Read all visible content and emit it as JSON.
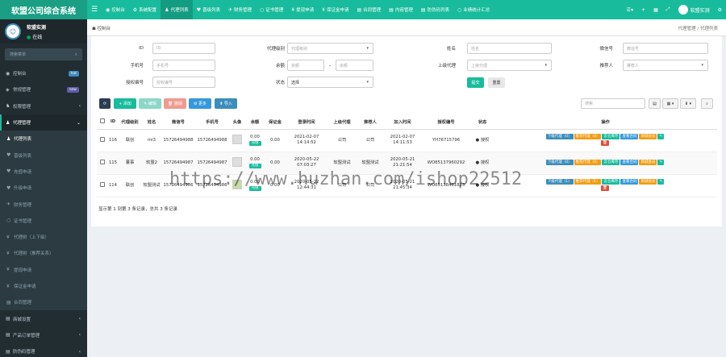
{
  "app": {
    "brand": "软盟公司综合系统"
  },
  "topnav": {
    "toggle": "☰",
    "items": [
      {
        "icon": "◉",
        "label": "控制台"
      },
      {
        "icon": "⚙",
        "label": "系统配置"
      },
      {
        "icon": "♟",
        "label": "代理列表"
      },
      {
        "icon": "♥",
        "label": "晋级列表"
      },
      {
        "icon": "✈",
        "label": "财务管理"
      },
      {
        "icon": "○",
        "label": "证书管理"
      },
      {
        "icon": "¥",
        "label": "提现申请"
      },
      {
        "icon": "¥",
        "label": "保证金申请"
      },
      {
        "icon": "▤",
        "label": "合同管理"
      },
      {
        "icon": "▤",
        "label": "内容管理"
      },
      {
        "icon": "▤",
        "label": "防伪码列表"
      },
      {
        "icon": "○",
        "label": "业绩统计汇总"
      }
    ],
    "right": {
      "menu": "☰",
      "lang": "▾",
      "plus": "+",
      "grid": "▦",
      "fullscreen": "⤢",
      "user": "软盟实测",
      "gear": "⚙"
    }
  },
  "sidebar": {
    "user_name": "软盟实测",
    "user_status": "在线",
    "search_placeholder": "搜索菜单",
    "items": [
      {
        "icon": "◉",
        "label": "控制台",
        "badge": "hot",
        "badge_color": "#3c8dbc"
      },
      {
        "icon": "◈",
        "label": "常规管理",
        "badge": "new",
        "badge_color": "#605ca8"
      },
      {
        "icon": "♞",
        "label": "权限管理",
        "arrow": "‹"
      },
      {
        "icon": "♟",
        "label": "代理管理",
        "arrow": "⌄"
      }
    ],
    "subitems": [
      {
        "icon": "♟",
        "label": "代理列表"
      },
      {
        "icon": "♥",
        "label": "晋级列表"
      },
      {
        "icon": "♥",
        "label": "充值申请"
      },
      {
        "icon": "♥",
        "label": "升级申请"
      },
      {
        "icon": "✈",
        "label": "财务管理"
      },
      {
        "icon": "○",
        "label": "证书管理"
      },
      {
        "icon": "¥",
        "label": "代理树（上下级）"
      },
      {
        "icon": "¥",
        "label": "代理树（推荐关系）"
      },
      {
        "icon": "¥",
        "label": "提现申请"
      },
      {
        "icon": "¥",
        "label": "保证金申请"
      },
      {
        "icon": "▤",
        "label": "合同管理"
      }
    ],
    "bottom_items": [
      {
        "icon": "▤",
        "label": "商城设置"
      },
      {
        "icon": "▤",
        "label": "产品订单管理"
      },
      {
        "icon": "▤",
        "label": "防伪码管理"
      }
    ]
  },
  "breadcrumb": {
    "left": "☗ 控制台",
    "right": "代理管理 / 代理列表"
  },
  "search_form": {
    "id_label": "ID",
    "id_placeholder": "ID",
    "level_label": "代理级别",
    "level_value": "代理级别",
    "name_label": "姓名",
    "name_placeholder": "姓名",
    "wechat_label": "微信号",
    "wechat_placeholder": "微信号",
    "phone_label": "手机号",
    "phone_placeholder": "手机号",
    "balance_label": "余额",
    "balance_min": "余额",
    "balance_sep": "-",
    "balance_max": "余额",
    "parent_label": "上级代理",
    "parent_value": "上级代理",
    "referrer_label": "推荐人",
    "referrer_value": "推荐人",
    "auth_label": "授权编号",
    "auth_placeholder": "授权编号",
    "status_label": "状态",
    "status_value": "选择",
    "submit": "提交",
    "reset": "重置"
  },
  "toolbar": {
    "refresh": "⟳",
    "add": "+ 添加",
    "edit": "✎ 编辑",
    "delete": "🗑 删除",
    "more": "⚙ 更多",
    "import": "⬆ 导入",
    "search_placeholder": "搜索",
    "view_btn": "▤",
    "columns_btn": "▦ ▾",
    "export_btn": "⬇ ▾",
    "search_btn": "⌕"
  },
  "table": {
    "columns": [
      "ID",
      "代理级别",
      "姓名",
      "微信号",
      "手机号",
      "头像",
      "余额",
      "保证金",
      "登录时间",
      "上级代理",
      "推荐人",
      "加入时间",
      "授权编号",
      "状态",
      "操作"
    ],
    "rows": [
      {
        "id": "116",
        "level": "联创",
        "name": "mi3",
        "wechat": "15726494988",
        "phone": "15726494988",
        "balance": "0.00",
        "recharge": "充值",
        "deposit": "0.00",
        "login_time": "2021-02-07 14:14:52",
        "parent": "公司",
        "referrer": "公司",
        "join_time": "2021-02-07 14:11:53",
        "auth_no": "YH76715796",
        "status": "● 授权"
      },
      {
        "id": "115",
        "level": "董事",
        "name": "软盟2",
        "wechat": "15726494987",
        "phone": "15726494987",
        "balance": "0.00",
        "recharge": "充值",
        "deposit": "0.00",
        "login_time": "2020-05-22 07:03:27",
        "parent": "软盟测试",
        "referrer": "软盟测试",
        "join_time": "2020-05-21 21:21:54",
        "auth_no": "WO85137960292",
        "status": "● 授权"
      },
      {
        "id": "114",
        "level": "联创",
        "name": "软盟测试",
        "wechat": "15726494986",
        "phone": "15726494986",
        "balance": "0.00",
        "recharge": "充值",
        "deposit": "0.00",
        "login_time": "2020-05-22 12:44:31",
        "parent": "公司",
        "referrer": "公司",
        "join_time": "2020-05-21 21:45:34",
        "auth_no": "WO85138461823",
        "status": "● 授权"
      }
    ],
    "ops": {
      "sub_agent": "下级代理（0）",
      "recommend_agent": "推荐代理（0）",
      "cloud_stock": "云仓库存",
      "view_contract": "查看合同",
      "mall_member": "商城会员",
      "sub_agent_1": "下级代理（1）",
      "recommend_agent_1": "推荐代理（1）"
    }
  },
  "pagination": {
    "info": "显示第 1 到第 3 条记录，总共 3 条记录"
  },
  "watermark": "https://www.huzhan.com/ishop22512"
}
